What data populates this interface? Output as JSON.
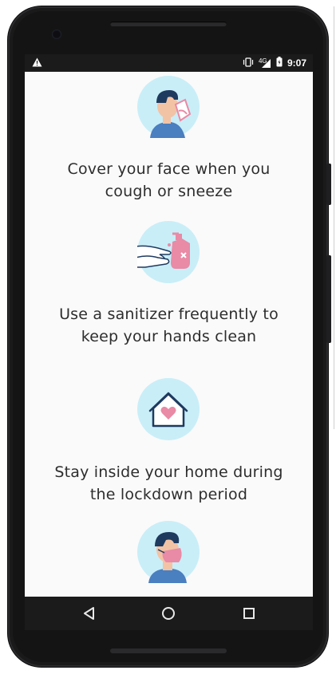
{
  "status_bar": {
    "time": "9:07",
    "network": "4G",
    "icons": [
      "warning-icon",
      "vibrate-icon",
      "signal-icon",
      "battery-charging-icon"
    ]
  },
  "tips": [
    {
      "icon": "cough-icon",
      "text_line1": "Cover your face when you",
      "text_line2": "cough or sneeze"
    },
    {
      "icon": "hand-sanitizer-icon",
      "text_line1": "Use a sanitizer frequently to",
      "text_line2": "keep your hands clean"
    },
    {
      "icon": "home-heart-icon",
      "text_line1": "Stay inside your home during",
      "text_line2": "the lockdown period"
    },
    {
      "icon": "face-mask-icon"
    }
  ],
  "nav_bar": {
    "icons": [
      "back-icon",
      "home-icon",
      "recents-icon"
    ]
  },
  "colors": {
    "icon_circle": "#c9eef8",
    "accent_pink": "#e98aa6",
    "navy": "#1e3a5f",
    "skin": "#f3c3a5"
  }
}
